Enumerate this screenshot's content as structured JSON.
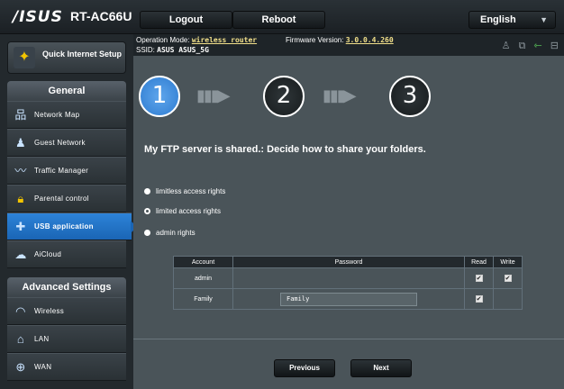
{
  "header": {
    "logo": "/ISUS",
    "model": "RT-AC66U",
    "logout_label": "Logout",
    "reboot_label": "Reboot",
    "language": "English"
  },
  "status": {
    "op_mode_label": "Operation Mode:",
    "op_mode_value": "wireless router",
    "fw_label": "Firmware Version:",
    "fw_value": "3.0.0.4.260",
    "ssid_label": "SSID:",
    "ssid_value": "ASUS  ASUS_5G"
  },
  "sidebar": {
    "quick_setup": "Quick Internet Setup",
    "general_header": "General",
    "general_items": [
      {
        "label": "Network Map",
        "icon": "network-map-icon"
      },
      {
        "label": "Guest Network",
        "icon": "guest-network-icon"
      },
      {
        "label": "Traffic Manager",
        "icon": "traffic-manager-icon"
      },
      {
        "label": "Parental control",
        "icon": "parental-control-icon"
      },
      {
        "label": "USB application",
        "icon": "usb-application-icon",
        "active": true
      },
      {
        "label": "AiCloud",
        "icon": "aicloud-icon"
      }
    ],
    "advanced_header": "Advanced Settings",
    "advanced_items": [
      {
        "label": "Wireless",
        "icon": "wireless-icon"
      },
      {
        "label": "LAN",
        "icon": "lan-icon"
      },
      {
        "label": "WAN",
        "icon": "wan-icon"
      }
    ]
  },
  "wizard": {
    "steps": [
      "1",
      "2",
      "3"
    ],
    "active_step": 1,
    "question": "My FTP server is shared.: Decide how to share your folders.",
    "options": [
      {
        "label": "limitless access rights",
        "selected": false
      },
      {
        "label": "limited access rights",
        "selected": true
      },
      {
        "label": "admin rights",
        "selected": false
      }
    ]
  },
  "table": {
    "headers": [
      "Account",
      "Password",
      "Read",
      "Write"
    ],
    "rows": [
      {
        "account": "admin",
        "password": "",
        "read": true,
        "write": true
      },
      {
        "account": "Family",
        "password": "Family",
        "read": true,
        "write": false
      }
    ]
  },
  "nav": {
    "previous_label": "Previous",
    "next_label": "Next"
  },
  "colors": {
    "accent": "#2d83d8",
    "panel": "#4a5459",
    "sidebar": "#23292d"
  }
}
